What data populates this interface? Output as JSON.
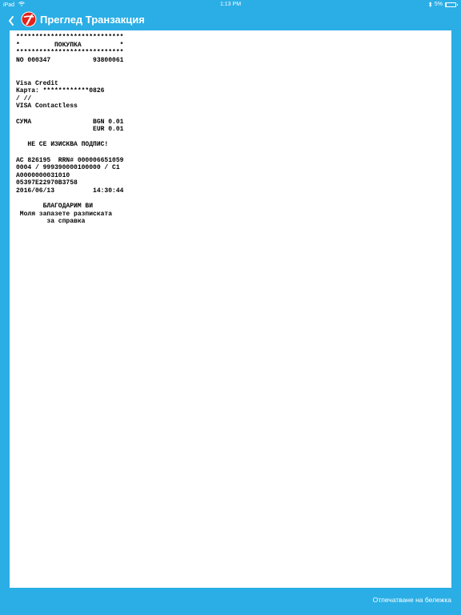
{
  "status_bar": {
    "device": "iPad",
    "wifi_icon": "wifi-icon",
    "time": "1:13 PM",
    "bluetooth_icon": "bluetooth-icon",
    "battery_percent": "5%",
    "battery_level": 0.05
  },
  "nav": {
    "back_icon": "chevron-left-icon",
    "logo_icon": "bank-logo",
    "title": "Преглед Транзакция"
  },
  "receipt": {
    "lines": [
      "****************************",
      "*         ПОКУПКА          *",
      "****************************",
      "NO 000347           93800061",
      "",
      "",
      "Visa Credit",
      "Карта: ************0826",
      "/ //",
      "VISA Contactless",
      "",
      "СУМА                BGN 0.01",
      "                    EUR 0.01",
      "",
      "   НЕ СЕ ИЗИСКВА ПОДПИС!",
      "",
      "AC 826195  RRN# 000006651059",
      "0004 / 999390000100000 / C1",
      "A0000000031010",
      "05397E22970B3758",
      "2016/06/13          14:30:44",
      "",
      "       БЛАГОДАРИМ ВИ",
      " Моля запазете разписката",
      "        за справка"
    ]
  },
  "bottom_bar": {
    "print_label": "Отпечатване на бележка"
  },
  "colors": {
    "background": "#2aaee5",
    "panel": "#ffffff",
    "logo_red": "#e2231a"
  }
}
